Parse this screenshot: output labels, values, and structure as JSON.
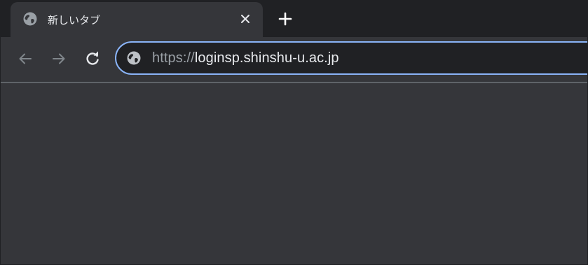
{
  "tab": {
    "title": "新しいタブ",
    "favicon": "globe-icon",
    "close_icon": "close-icon"
  },
  "new_tab": {
    "icon": "plus-icon"
  },
  "toolbar": {
    "back_icon": "arrow-left-icon",
    "forward_icon": "arrow-right-icon",
    "reload_icon": "reload-icon"
  },
  "omnibox": {
    "site_icon": "globe-icon",
    "url_scheme": "https://",
    "url_host": "loginsp.shinshu-u.ac.jp"
  },
  "colors": {
    "tabstrip_bg": "#202124",
    "active_tab_bg": "#35363a",
    "omnibox_bg": "#202124",
    "focus_ring": "#8ab4f8",
    "text_primary": "#e8eaed",
    "text_secondary": "#9aa0a6",
    "content_bg": "#35363a"
  }
}
